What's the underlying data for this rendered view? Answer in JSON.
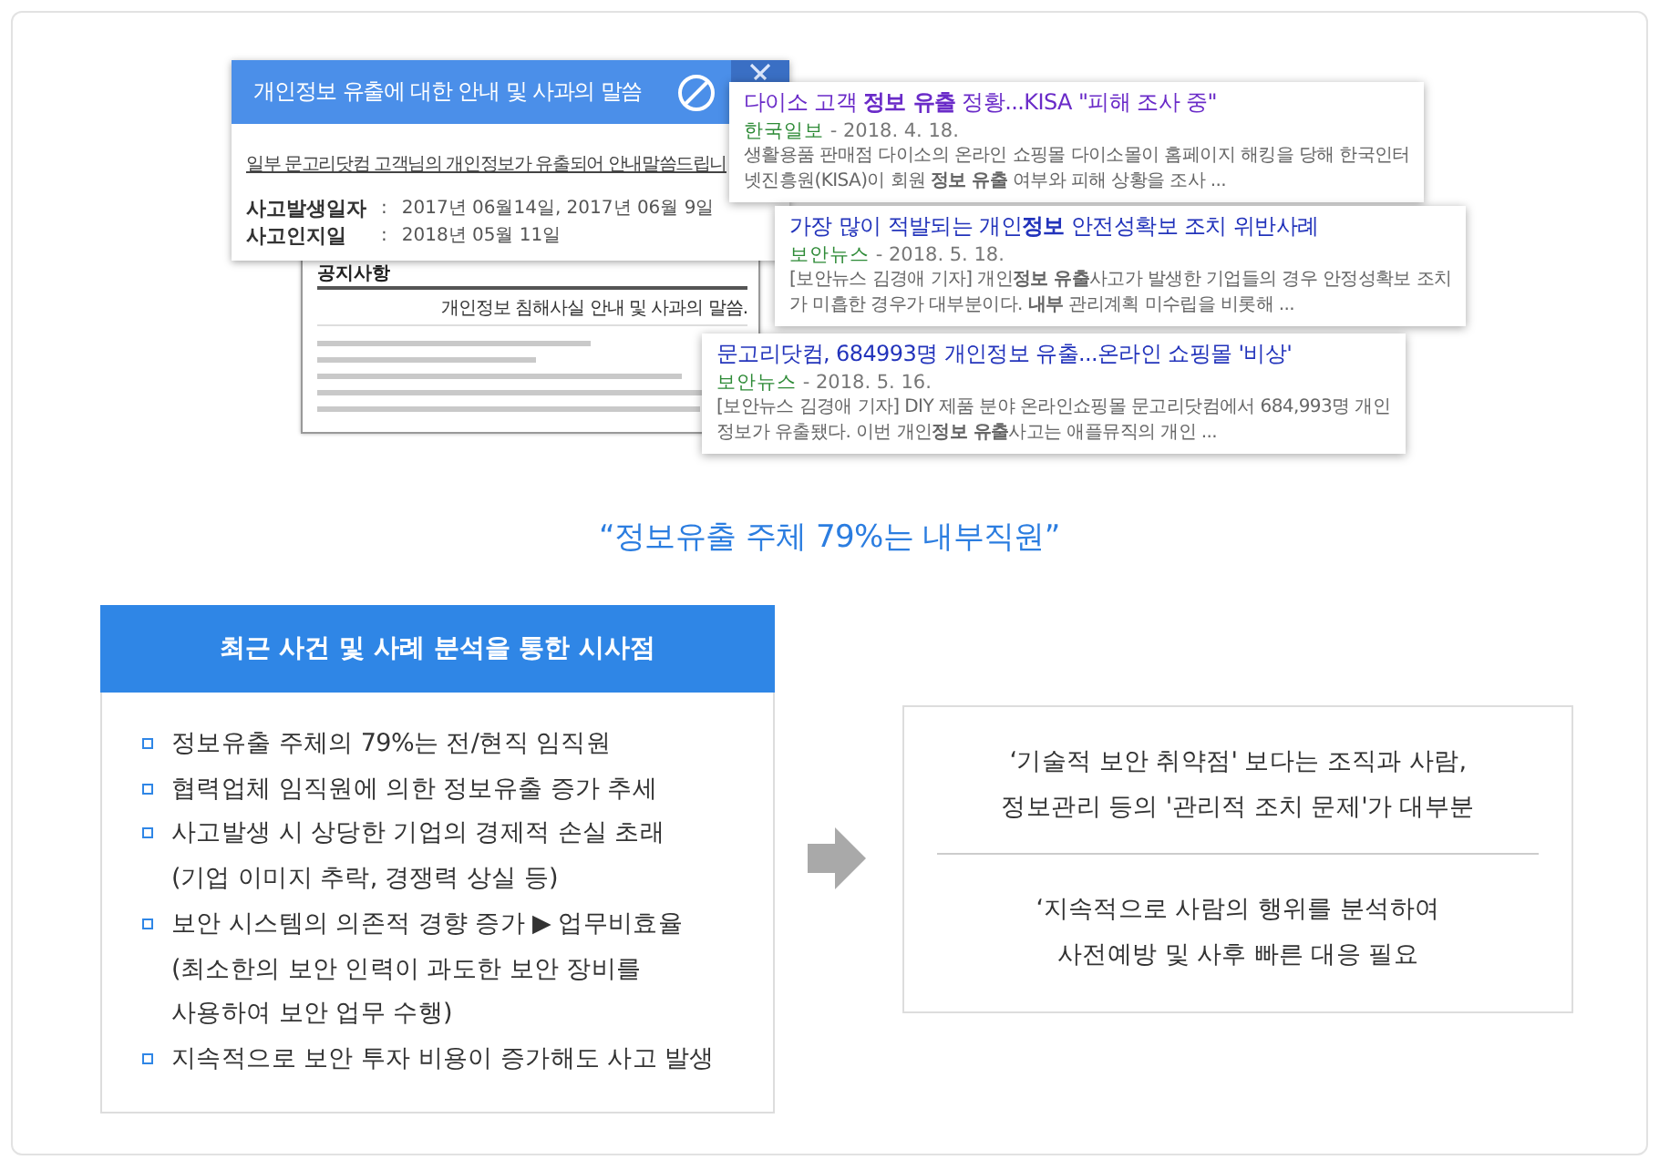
{
  "notice_popup": {
    "title": "개인정보 유출에 대한 안내 및 사과의 말씀",
    "link": "일부 문고리닷컴 고객님의 개인정보가 유출되어 안내말씀드립니",
    "fields": [
      {
        "label": "사고발생일자",
        "separator": ":",
        "value": "2017년 06월14일, 2017년 06월 9일"
      },
      {
        "label": "사고인지일",
        "separator": ":",
        "value": "2018년 05월 11일"
      }
    ]
  },
  "notice_document": {
    "heading": "공지사항",
    "subtitle": "개인정보 침해사실 안내 및 사과의 말씀."
  },
  "search_results": [
    {
      "title": "다이소 고객 **정보 유출** 정황...KISA \"피해 조사 중\"",
      "visited": true,
      "source": "한국일보",
      "date": "- 2018. 4. 18.",
      "snippet": [
        "생활용품 판매점 다이소의 온라인 쇼핑몰 다이소몰이 홈페이지 해킹을 당해 한국인터",
        "넷진흥원(KISA)이 회원 **정보 유출** 여부와 피해 상황을 조사 ..."
      ]
    },
    {
      "title": "가장 많이 적발되는 개인**정보** 안전성확보 조치 위반사례",
      "visited": false,
      "source": "보안뉴스",
      "date": "- 2018. 5. 18.",
      "snippet": [
        "[보안뉴스 김경애 기자] 개인**정보 유출**사고가 발생한 기업들의 경우 안정성확보 조치",
        "가 미흡한 경우가 대부분이다. **내부** 관리계획 미수립을 비롯해 ..."
      ]
    },
    {
      "title": "문고리닷컴, 684993명 개인정보 유출...온라인 쇼핑몰 '비상'",
      "visited": false,
      "source": "보안뉴스",
      "date": "- 2018. 5. 16.",
      "snippet": [
        "[보안뉴스 김경애 기자] DIY 제품 분야 온라인쇼핑몰 문고리닷컴에서 684,993명 개인",
        "정보가 유출됐다. 이번 개인**정보 유출**사고는 애플뮤직의 개인 ..."
      ]
    }
  ],
  "quote": "“정보유출 주체 79%는 내부직원”",
  "findings_panel": {
    "title": "최근 사건 및 사례 분석을 통한 시사점",
    "items": [
      {
        "lines": [
          "정보유출 주체의 79%는 전/현직 임직원"
        ]
      },
      {
        "lines": [
          "협력업체 임직원에 의한 정보유출 증가 추세"
        ]
      },
      {
        "lines": [
          "사고발생 시 상당한 기업의 경제적 손실 초래",
          "(기업 이미지 추락, 경쟁력 상실 등)"
        ]
      },
      {
        "lines": [
          "보안 시스템의 의존적 경향 증가 ▶ 업무비효율",
          "(최소한의 보안 인력이 과도한 보안 장비를",
          "사용하여 보안 업무 수행)"
        ]
      },
      {
        "lines": [
          "지속적으로 보안 투자 비용이 증가해도 사고 발생"
        ]
      }
    ]
  },
  "conclusion": {
    "statements": [
      [
        "‘기술적 보안 취약점' 보다는 조직과 사람,",
        "정보관리 등의 '관리적 조치 문제'가 대부분"
      ],
      [
        "‘지속적으로 사람의 행위를 분석하여",
        "사전예방 및 사후 빠른 대응 필요"
      ]
    ]
  }
}
